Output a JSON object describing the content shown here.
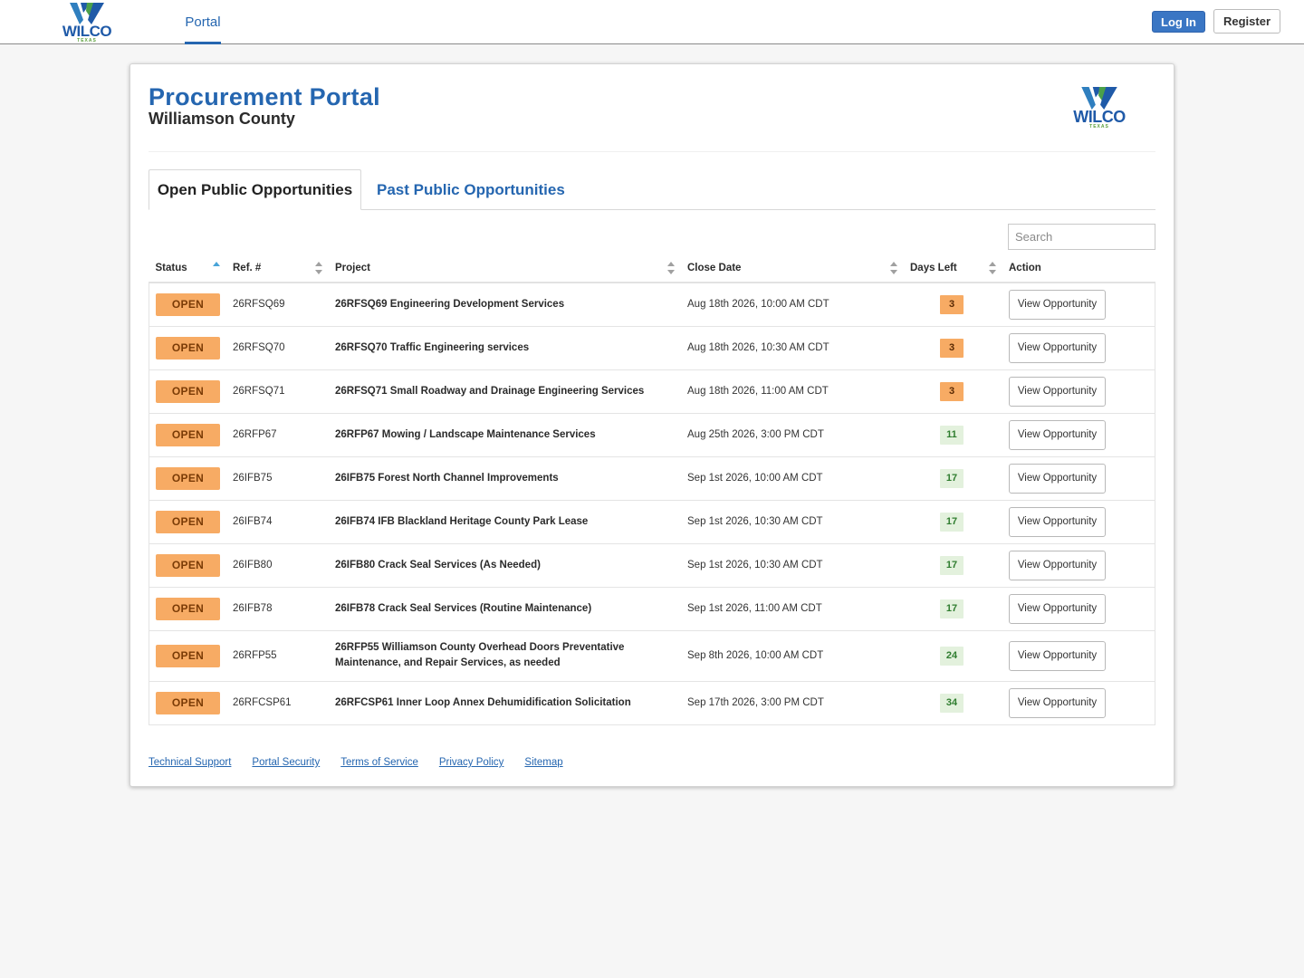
{
  "header": {
    "logo": {
      "wordmark": "WILCO",
      "sub": "TEXAS"
    },
    "nav_tab": "Portal",
    "login_label": "Log In",
    "register_label": "Register"
  },
  "page": {
    "title": "Procurement Portal",
    "subtitle": "Williamson County",
    "logo": {
      "wordmark": "WILCO",
      "sub": "TEXAS"
    }
  },
  "tabs": {
    "open": "Open Public Opportunities",
    "past": "Past Public Opportunities"
  },
  "search": {
    "placeholder": "Search"
  },
  "table": {
    "headers": {
      "status": "Status",
      "ref": "Ref. #",
      "project": "Project",
      "close": "Close Date",
      "days": "Days Left",
      "action": "Action"
    },
    "action_label": "View Opportunity",
    "rows": [
      {
        "status": "OPEN",
        "ref": "26RFSQ69",
        "project": "26RFSQ69 Engineering Development Services",
        "close": "Aug 18th 2026, 10:00 AM CDT",
        "days": "3"
      },
      {
        "status": "OPEN",
        "ref": "26RFSQ70",
        "project": "26RFSQ70 Traffic Engineering services",
        "close": "Aug 18th 2026, 10:30 AM CDT",
        "days": "3"
      },
      {
        "status": "OPEN",
        "ref": "26RFSQ71",
        "project": "26RFSQ71 Small Roadway and Drainage Engineering Services",
        "close": "Aug 18th 2026, 11:00 AM CDT",
        "days": "3"
      },
      {
        "status": "OPEN",
        "ref": "26RFP67",
        "project": "26RFP67 Mowing / Landscape Maintenance Services",
        "close": "Aug 25th 2026, 3:00 PM CDT",
        "days": "11"
      },
      {
        "status": "OPEN",
        "ref": "26IFB75",
        "project": "26IFB75 Forest North Channel Improvements",
        "close": "Sep 1st 2026, 10:00 AM CDT",
        "days": "17"
      },
      {
        "status": "OPEN",
        "ref": "26IFB74",
        "project": "26IFB74 IFB Blackland Heritage County Park Lease",
        "close": "Sep 1st 2026, 10:30 AM CDT",
        "days": "17"
      },
      {
        "status": "OPEN",
        "ref": "26IFB80",
        "project": "26IFB80 Crack Seal Services (As Needed)",
        "close": "Sep 1st 2026, 10:30 AM CDT",
        "days": "17"
      },
      {
        "status": "OPEN",
        "ref": "26IFB78",
        "project": "26IFB78 Crack Seal Services (Routine Maintenance)",
        "close": "Sep 1st 2026, 11:00 AM CDT",
        "days": "17"
      },
      {
        "status": "OPEN",
        "ref": "26RFP55",
        "project": "26RFP55 Williamson County Overhead Doors Preventative Maintenance, and Repair Services, as needed",
        "close": "Sep 8th 2026, 10:00 AM CDT",
        "days": "24"
      },
      {
        "status": "OPEN",
        "ref": "26RFCSP61",
        "project": "26RFCSP61 Inner Loop Annex Dehumidification Solicitation",
        "close": "Sep 17th 2026, 3:00 PM CDT",
        "days": "34"
      }
    ]
  },
  "footer": {
    "links": [
      "Technical Support",
      "Portal Security",
      "Terms of Service",
      "Privacy Policy",
      "Sitemap"
    ]
  },
  "colors": {
    "brand_blue": "#2566b0",
    "status_open": "#f7ab64",
    "days_ok_bg": "#e3f1dd",
    "days_ok_text": "#2f7d2f"
  }
}
